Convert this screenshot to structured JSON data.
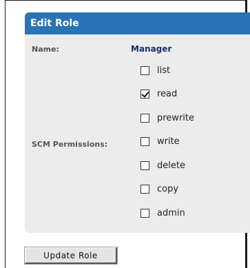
{
  "panel": {
    "title": "Edit Role"
  },
  "form": {
    "name_label": "Name:",
    "name_value": "Manager",
    "permissions_label": "SCM Permissions:",
    "permissions": [
      {
        "label": "list",
        "checked": false
      },
      {
        "label": "read",
        "checked": true
      },
      {
        "label": "prewrite",
        "checked": false
      },
      {
        "label": "write",
        "checked": false
      },
      {
        "label": "delete",
        "checked": false
      },
      {
        "label": "copy",
        "checked": false
      },
      {
        "label": "admin",
        "checked": false
      }
    ]
  },
  "actions": {
    "update_label": "Update Role"
  },
  "colors": {
    "header_bg": "#2a74b6",
    "panel_bg": "#ececec",
    "name_value": "#1a2f6e"
  }
}
